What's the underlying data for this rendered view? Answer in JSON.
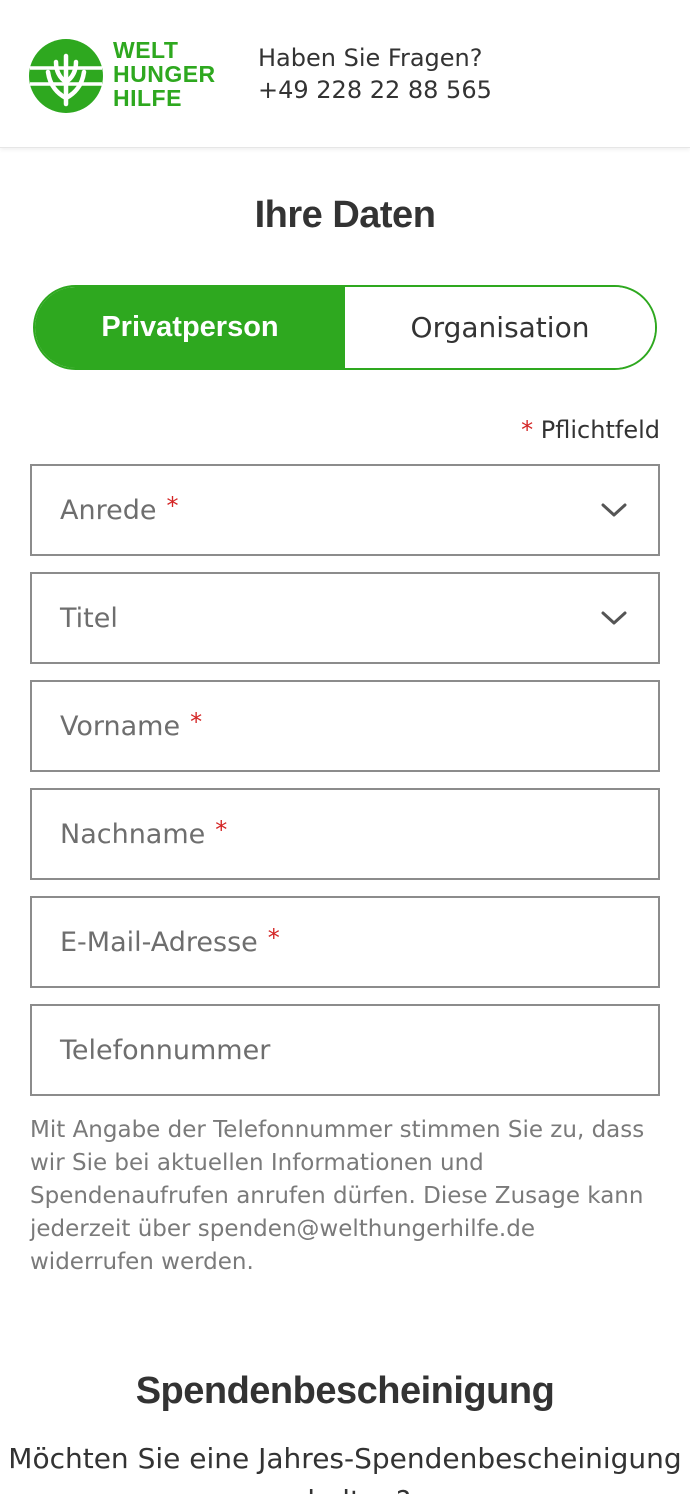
{
  "header": {
    "logo_lines": [
      "WELT",
      "HUNGER",
      "HILFE"
    ],
    "contact_question": "Haben Sie Fragen?",
    "contact_phone": "+49 228 22 88 565",
    "brand_color": "#2ea81f"
  },
  "personal": {
    "title": "Ihre Daten",
    "toggle": {
      "options": [
        "Privatperson",
        "Organisation"
      ],
      "selected": "Privatperson"
    },
    "required_star": "*",
    "required_label": "Pflichtfeld",
    "fields": {
      "salutation": {
        "placeholder": "Anrede",
        "required": true,
        "type": "select",
        "icon": "chevron-down-icon"
      },
      "title": {
        "placeholder": "Titel",
        "required": false,
        "type": "select",
        "icon": "chevron-down-icon"
      },
      "first_name": {
        "placeholder": "Vorname",
        "required": true,
        "type": "text"
      },
      "last_name": {
        "placeholder": "Nachname",
        "required": true,
        "type": "text"
      },
      "email": {
        "placeholder": "E-Mail-Adresse",
        "required": true,
        "type": "email"
      },
      "phone": {
        "placeholder": "Telefonnummer",
        "required": false,
        "type": "tel"
      }
    },
    "phone_consent": "Mit Angabe der Telefonnummer stimmen Sie zu, dass wir Sie bei aktuellen Informationen und Spendenaufrufen anrufen dürfen. Diese Zusage kann jederzeit über spenden@welthungerhilfe.de widerrufen werden."
  },
  "receipt": {
    "title": "Spendenbescheinigung",
    "question": "Möchten Sie eine Jahres-Spendenbescheinigung erhalten?"
  },
  "colors": {
    "required": "#d42525",
    "border": "#8c8c8c",
    "placeholder": "#6e6e6e"
  }
}
